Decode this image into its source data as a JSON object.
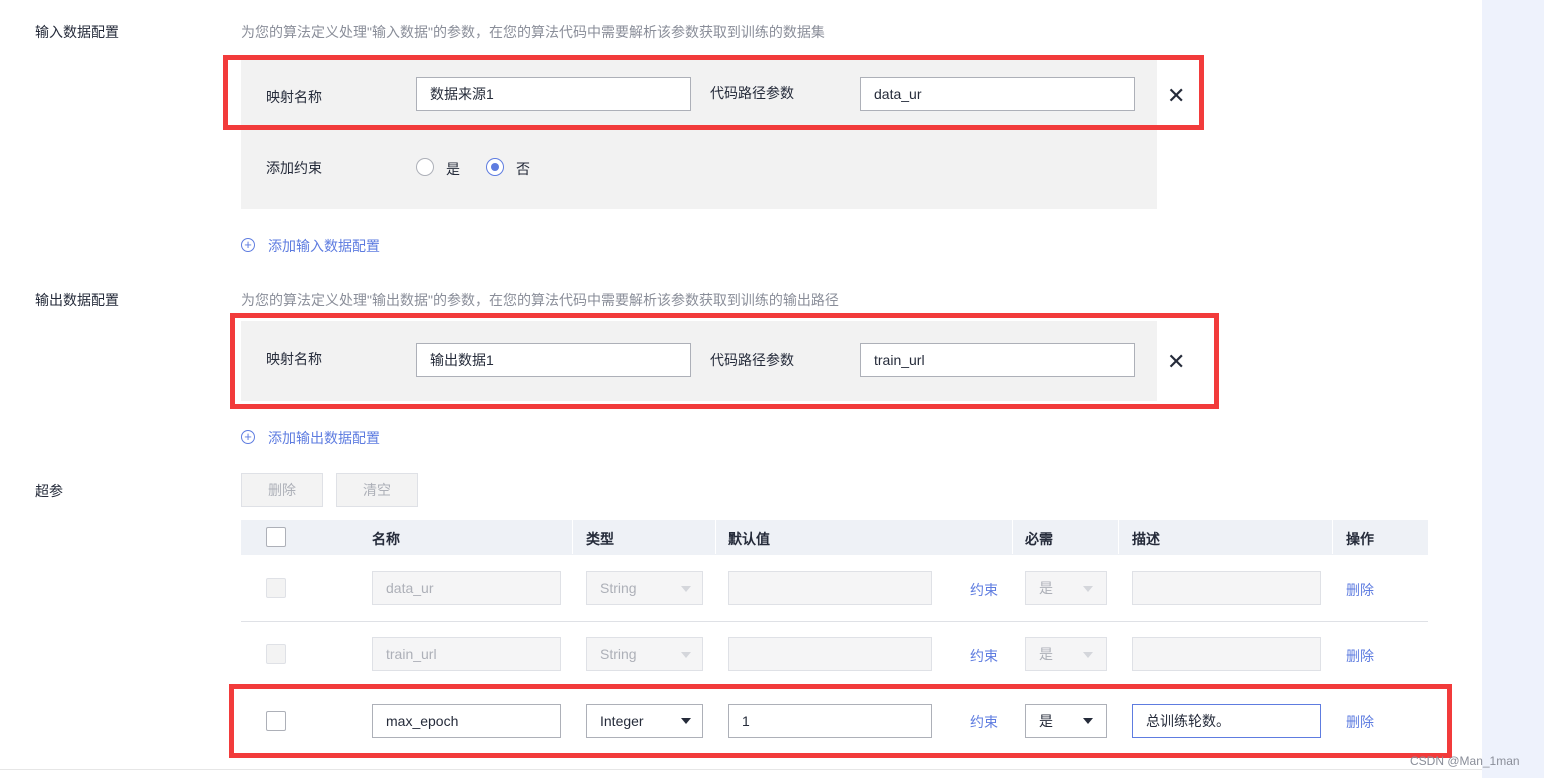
{
  "input_config": {
    "label": "输入数据配置",
    "hint": "为您的算法定义处理\"输入数据\"的参数，在您的算法代码中需要解析该参数获取到训练的数据集",
    "mapping_name_label": "映射名称",
    "mapping_name_value": "数据来源1",
    "code_path_label": "代码路径参数",
    "code_path_value": "data_ur",
    "constraint_label": "添加约束",
    "radio_yes": "是",
    "radio_no": "否",
    "selected": "否",
    "add_link": "添加输入数据配置"
  },
  "output_config": {
    "label": "输出数据配置",
    "hint": "为您的算法定义处理\"输出数据\"的参数，在您的算法代码中需要解析该参数获取到训练的输出路径",
    "mapping_name_label": "映射名称",
    "mapping_name_value": "输出数据1",
    "code_path_label": "代码路径参数",
    "code_path_value": "train_url",
    "add_link": "添加输出数据配置"
  },
  "hyperparams": {
    "label": "超参",
    "delete_button": "删除",
    "clear_button": "清空",
    "columns": {
      "name": "名称",
      "type": "类型",
      "default": "默认值",
      "required": "必需",
      "description": "描述",
      "action": "操作"
    },
    "rows": [
      {
        "name": "data_ur",
        "type": "String",
        "default": "",
        "constraint": "约束",
        "required": "是",
        "description": "",
        "action": "删除",
        "disabled": true
      },
      {
        "name": "train_url",
        "type": "String",
        "default": "",
        "constraint": "约束",
        "required": "是",
        "description": "",
        "action": "删除",
        "disabled": true
      },
      {
        "name": "max_epoch",
        "type": "Integer",
        "default": "1",
        "constraint": "约束",
        "required": "是",
        "description": "总训练轮数。",
        "action": "删除",
        "disabled": false
      }
    ]
  },
  "watermark": "CSDN @Man_1man",
  "colors": {
    "accent": "#5e7ce0",
    "highlight": "#f23b3b",
    "panel": "#f2f2f2"
  }
}
